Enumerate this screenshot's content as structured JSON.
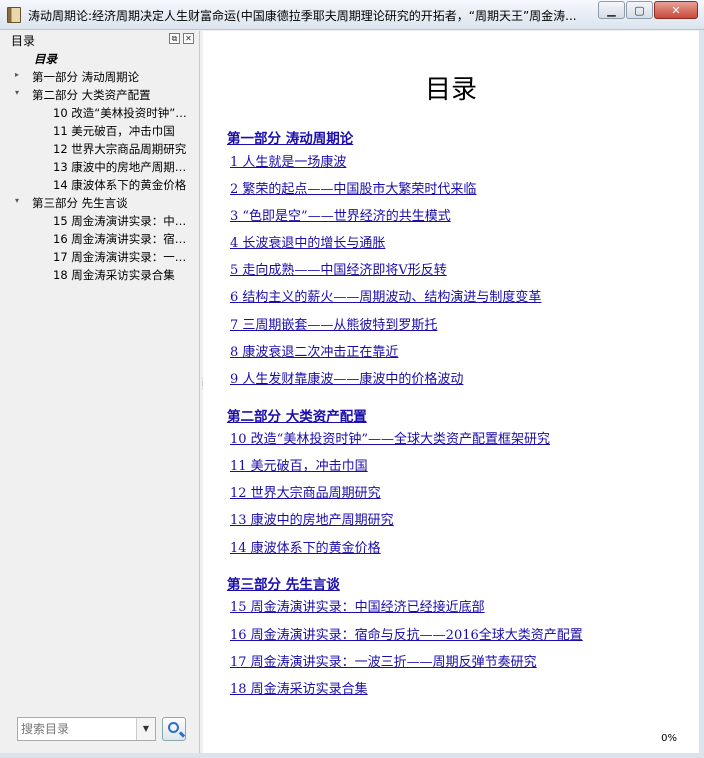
{
  "window": {
    "title": "涛动周期论:经济周期决定人生财富命运(中国康德拉季耶夫周期理论研究的开拓者，“周期天王”周金涛..."
  },
  "sidebar": {
    "title": "目录",
    "root_label": "目录",
    "items": [
      {
        "label": "第一部分  涛动周期论",
        "arrow": "▸",
        "level": 1
      },
      {
        "label": "第二部分  大类资产配置",
        "arrow": "▾",
        "level": 1
      },
      {
        "label": "10 改造“美林投资时钟”…",
        "level": 2
      },
      {
        "label": "11 美元破百，冲击巾国",
        "level": 2
      },
      {
        "label": "12 世界大宗商品周期研究",
        "level": 2
      },
      {
        "label": "13 康波中的房地产周期…",
        "level": 2
      },
      {
        "label": "14 康波体系下的黄金价格",
        "level": 2
      },
      {
        "label": "第三部分  先生言谈",
        "arrow": "▾",
        "level": 1
      },
      {
        "label": "15 周金涛演讲实录：中…",
        "level": 2
      },
      {
        "label": "16 周金涛演讲实录：宿…",
        "level": 2
      },
      {
        "label": "17 周金涛演讲实录：一…",
        "level": 2
      },
      {
        "label": "18 周金涛采访实录合集",
        "level": 2
      }
    ],
    "search": {
      "placeholder": "搜索目录"
    }
  },
  "content": {
    "title": "目录",
    "sections": [
      {
        "heading": "第一部分 涛动周期论",
        "links": [
          "1 人生就是一场康波",
          "2 繁荣的起点——中国股市大繁荣时代来临",
          "3 “色即是空”——世界经济的共生模式",
          "4 长波衰退中的增长与通胀",
          "5 走向成熟——中国经济即将V形反转",
          "6 结构主义的薪火——周期波动、结构演进与制度变革",
          "7 三周期嵌套——从熊彼特到罗斯托",
          "8 康波衰退二次冲击正在靠近",
          "9 人生发财靠康波——康波中的价格波动"
        ]
      },
      {
        "heading": "第二部分 大类资产配置",
        "links": [
          "10 改造“美林投资时钟”——全球大类资产配置框架研究",
          "11 美元破百，冲击巾国",
          "12 世界大宗商品周期研究",
          "13 康波中的房地产周期研究",
          "14 康波体系下的黄金价格"
        ]
      },
      {
        "heading": "第三部分 先生言谈",
        "links": [
          "15 周金涛演讲实录：中国经济已经接近底部",
          "16 周金涛演讲实录：宿命与反抗——2016全球大类资产配置",
          "17 周金涛演讲实录：一波三折——周期反弹节奏研究",
          "18 周金涛采访实录合集"
        ]
      }
    ],
    "progress": "0%"
  }
}
